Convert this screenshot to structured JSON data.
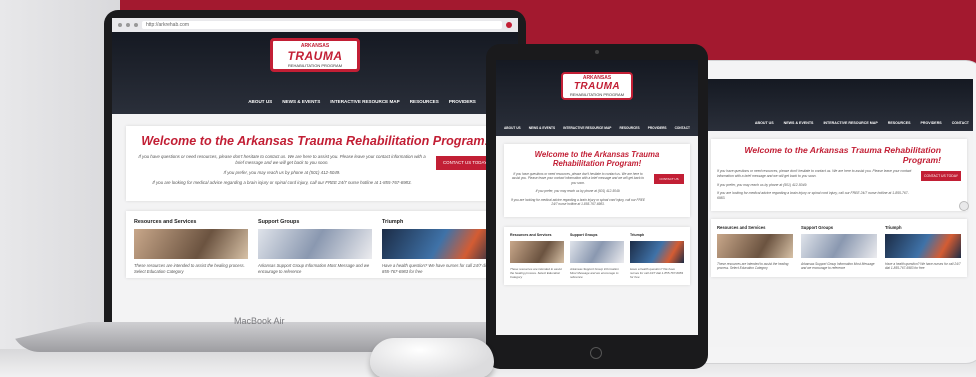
{
  "site": {
    "browser_url": "http://arkrehab.com",
    "logo": {
      "line1": "ARKANSAS",
      "line2": "TRAUMA",
      "line3": "REHABILITATION PROGRAM"
    },
    "nav": [
      "ABOUT US",
      "NEWS & EVENTS",
      "INTERACTIVE RESOURCE MAP",
      "RESOURCES",
      "PROVIDERS",
      "CONTACT"
    ],
    "welcome_title": "Welcome to the Arkansas Trauma Rehabilitation Program!",
    "welcome_p1": "If you have questions or need resources, please don't hesitate to contact us. We are here to assist you. Please leave your contact information with a brief message and we will get back to you soon.",
    "welcome_p2": "If you prefer, you may reach us by phone at (501) 412-5049.",
    "welcome_p3": "If you are looking for medical advice regarding a brain injury or spinal cord injury, call our FREE 24/7 nurse hotline at 1-855-767-6983.",
    "contact_button": "CONTACT US TODAY",
    "cards": [
      {
        "title": "Resources and Services",
        "text": "These resources are intended to assist the healing process. Select Education Category"
      },
      {
        "title": "Support Groups",
        "text": "Arkansas Support Group Information Most Message and we encourage to reference"
      },
      {
        "title": "Triumph",
        "text": "Have a health question? We have nurses for call 24/7 dial 1-855-767-6983 for free"
      }
    ]
  },
  "laptop": {
    "brand": "MacBook Air"
  },
  "colors": {
    "accent": "#c21f35",
    "header": "#1e222c",
    "background": "#a3192f"
  }
}
